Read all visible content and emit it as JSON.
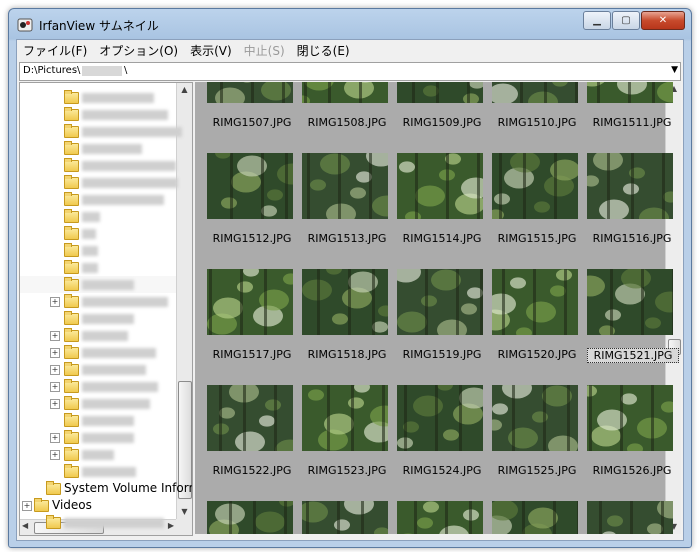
{
  "window": {
    "title": "IrfanView サムネイル"
  },
  "menu": [
    {
      "label": "ファイル(F)",
      "disabled": false
    },
    {
      "label": "オプション(O)",
      "disabled": false
    },
    {
      "label": "表示(V)",
      "disabled": false
    },
    {
      "label": "中止(S)",
      "disabled": true
    },
    {
      "label": "閉じる(E)",
      "disabled": false
    }
  ],
  "path": {
    "value": "D:\\Pictures\\",
    "suffix": "\\"
  },
  "tree": {
    "named_items": [
      {
        "label": "System Volume Inform"
      },
      {
        "label": "Videos"
      }
    ]
  },
  "thumbnails": {
    "rows": [
      [
        "RIMG1507.JPG",
        "RIMG1508.JPG",
        "RIMG1509.JPG",
        "RIMG1510.JPG",
        "RIMG1511.JPG"
      ],
      [
        "RIMG1512.JPG",
        "RIMG1513.JPG",
        "RIMG1514.JPG",
        "RIMG1515.JPG",
        "RIMG1516.JPG"
      ],
      [
        "RIMG1517.JPG",
        "RIMG1518.JPG",
        "RIMG1519.JPG",
        "RIMG1520.JPG",
        "RIMG1521.JPG"
      ],
      [
        "RIMG1522.JPG",
        "RIMG1523.JPG",
        "RIMG1524.JPG",
        "RIMG1525.JPG",
        "RIMG1526.JPG"
      ]
    ],
    "selected": "RIMG1521.JPG"
  },
  "colors": {
    "titlebar": "#bcd3ec",
    "thumb_bg": "#ababab",
    "close": "#c74a2c"
  },
  "icons": [
    "app-icon",
    "minimize-icon",
    "maximize-icon",
    "close-icon",
    "dropdown-icon",
    "folder-icon",
    "expand-icon",
    "scroll-up-icon",
    "scroll-down-icon",
    "scroll-left-icon",
    "scroll-right-icon"
  ]
}
